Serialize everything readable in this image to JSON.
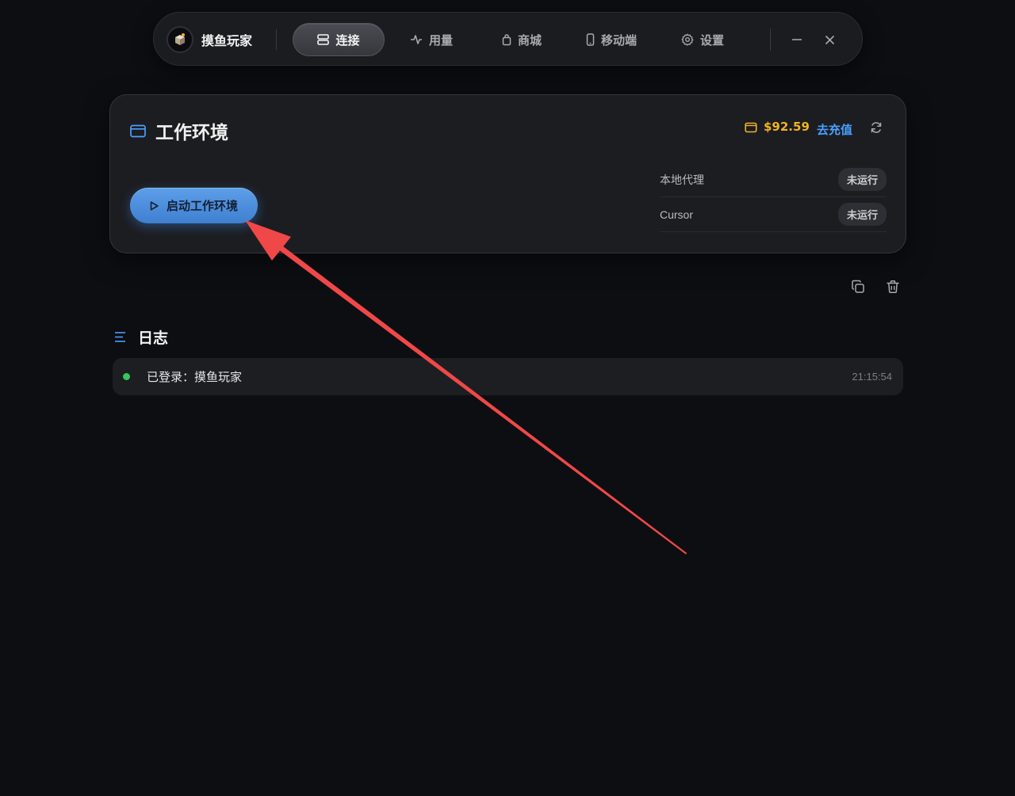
{
  "brand": {
    "name": "摸鱼玩家"
  },
  "nav": {
    "items": [
      {
        "label": "连接",
        "icon": "server-icon",
        "active": true
      },
      {
        "label": "用量",
        "icon": "activity-icon"
      },
      {
        "label": "商城",
        "icon": "shopping-bag-icon"
      },
      {
        "label": "移动端",
        "icon": "smartphone-icon"
      },
      {
        "label": "设置",
        "icon": "gear-icon"
      }
    ]
  },
  "workspace": {
    "title": "工作环境",
    "balance": "$92.59",
    "recharge_label": "去充值",
    "start_label": "启动工作环境",
    "statuses": [
      {
        "label": "本地代理",
        "state": "未运行"
      },
      {
        "label": "Cursor",
        "state": "未运行"
      }
    ]
  },
  "log": {
    "title": "日志",
    "entries": [
      {
        "message": "已登录：摸鱼玩家",
        "time": "21:15:54",
        "status_color": "#34c759"
      }
    ]
  },
  "colors": {
    "accent_blue": "#4aa0ff",
    "balance_gold": "#f0b323",
    "annotation_red": "#f04848"
  }
}
